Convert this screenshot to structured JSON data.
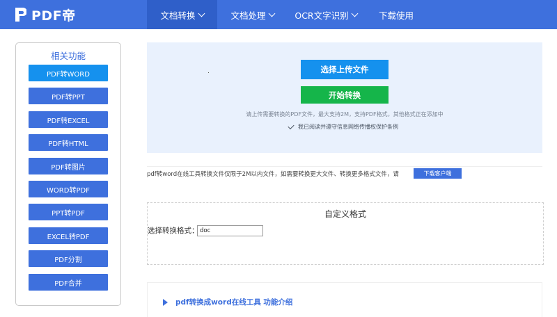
{
  "header": {
    "logo_text": "PDF帝",
    "nav": [
      {
        "label": "文档转换",
        "dropdown": true
      },
      {
        "label": "文档处理",
        "dropdown": true
      },
      {
        "label": "OCR文字识别",
        "dropdown": true
      },
      {
        "label": "下载使用",
        "dropdown": false
      }
    ]
  },
  "sidebar": {
    "title": "相关功能",
    "items": [
      {
        "label": "PDF转WORD"
      },
      {
        "label": "PDF转PPT"
      },
      {
        "label": "PDF转EXCEL"
      },
      {
        "label": "PDF转HTML"
      },
      {
        "label": "PDF转图片"
      },
      {
        "label": "WORD转PDF"
      },
      {
        "label": "PPT转PDF"
      },
      {
        "label": "EXCEL转PDF"
      },
      {
        "label": "PDF分割"
      },
      {
        "label": "PDF合并"
      }
    ]
  },
  "upload": {
    "select_button": "选择上传文件",
    "convert_button": "开始转换",
    "hint": "请上传需要转换的PDF文件，最大支持2M，支持PDF格式，其他格式正在添加中",
    "agree_text": "我已阅读并遵守信息网络传播权保护条例"
  },
  "notice": {
    "text": "pdf转word在线工具转换文件仅限于2M以内文件，如需要转换更大文件、转换更多格式文件，请",
    "download_button": "下载客户端"
  },
  "custom_format": {
    "title": "自定义格式",
    "label": "选择转换格式：",
    "value": "doc"
  },
  "intro": {
    "title": "pdf转换成word在线工具 功能介绍"
  },
  "colors": {
    "primary": "#3e70dd",
    "accent_blue": "#1591ee",
    "green": "#15b54a",
    "panel_bg": "#e9f1fd"
  }
}
